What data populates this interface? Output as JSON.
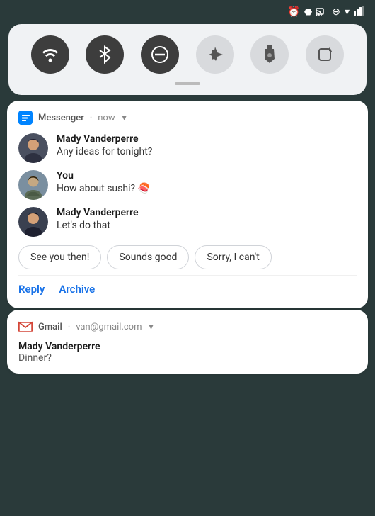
{
  "statusBar": {
    "icons": [
      "alarm",
      "bluetooth",
      "cast",
      "dnd",
      "wifi",
      "signal"
    ]
  },
  "quickSettings": {
    "buttons": [
      {
        "id": "wifi",
        "icon": "▼",
        "active": true,
        "label": "Wi-Fi"
      },
      {
        "id": "bluetooth",
        "icon": "⬡",
        "active": true,
        "label": "Bluetooth"
      },
      {
        "id": "dnd",
        "icon": "⊖",
        "active": true,
        "label": "Do Not Disturb"
      },
      {
        "id": "airplane",
        "icon": "✈",
        "active": false,
        "label": "Airplane Mode"
      },
      {
        "id": "flashlight",
        "icon": "🔦",
        "active": false,
        "label": "Flashlight"
      },
      {
        "id": "rotate",
        "icon": "⟳",
        "active": false,
        "label": "Auto-rotate"
      }
    ]
  },
  "messengerNotif": {
    "appName": "Messenger",
    "time": "now",
    "messages": [
      {
        "sender": "Mady Vanderperre",
        "text": "Any ideas for tonight?",
        "avatarType": "mady1"
      },
      {
        "sender": "You",
        "text": "How about sushi? 🍣",
        "avatarType": "you"
      },
      {
        "sender": "Mady Vanderperre",
        "text": "Let's do that",
        "avatarType": "mady2"
      }
    ],
    "quickReplies": [
      {
        "id": "see-you",
        "label": "See you then!"
      },
      {
        "id": "sounds-good",
        "label": "Sounds good"
      },
      {
        "id": "sorry",
        "label": "Sorry, I can't"
      }
    ],
    "actions": [
      {
        "id": "reply",
        "label": "Reply"
      },
      {
        "id": "archive",
        "label": "Archive"
      }
    ]
  },
  "gmailNotif": {
    "appName": "Gmail",
    "account": "van@gmail.com",
    "sender": "Mady Vanderperre",
    "subject": "Dinner?"
  }
}
